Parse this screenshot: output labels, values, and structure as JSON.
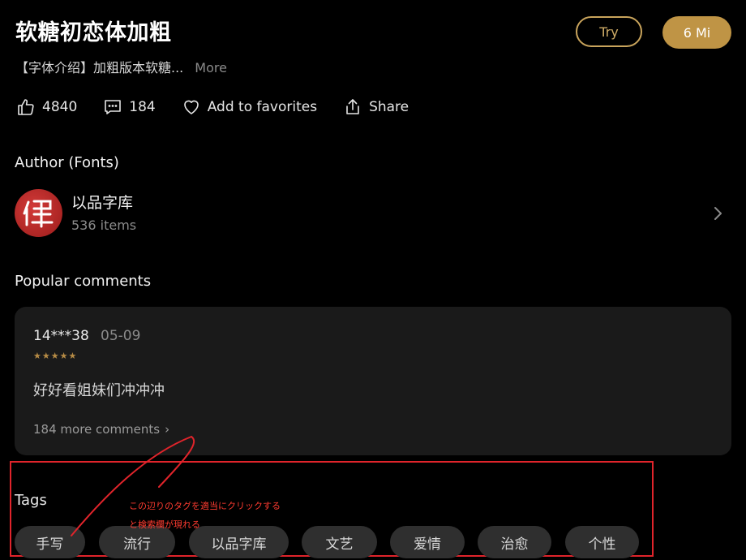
{
  "header": {
    "title": "软糖初恋体加粗",
    "intro": "【字体介绍】加粗版本软糖...",
    "more_label": "More",
    "try_label": "Try",
    "price_label": "6 Mi"
  },
  "actions": {
    "likes": "4840",
    "comments": "184",
    "favorites_label": "Add to favorites",
    "share_label": "Share"
  },
  "author": {
    "section_title": "Author (Fonts)",
    "name": "以品字库",
    "items": "536 items"
  },
  "comments": {
    "section_title": "Popular comments",
    "items": [
      {
        "user": "14***38",
        "date": "05-09",
        "rating": 5,
        "text": "好好看姐妹们冲冲冲"
      }
    ],
    "more_label": "184 more comments"
  },
  "tags": {
    "section_title": "Tags",
    "items": [
      "手写",
      "流行",
      "以品字库",
      "文艺",
      "爱情",
      "治愈",
      "个性"
    ]
  },
  "annotation": {
    "line1": "この辺りのタグを適当にクリックする",
    "line2": "と検索欄が現れる"
  },
  "colors": {
    "accent_gold": "#bf9445",
    "star": "#b68b45",
    "annotation_red": "#e0242b"
  }
}
